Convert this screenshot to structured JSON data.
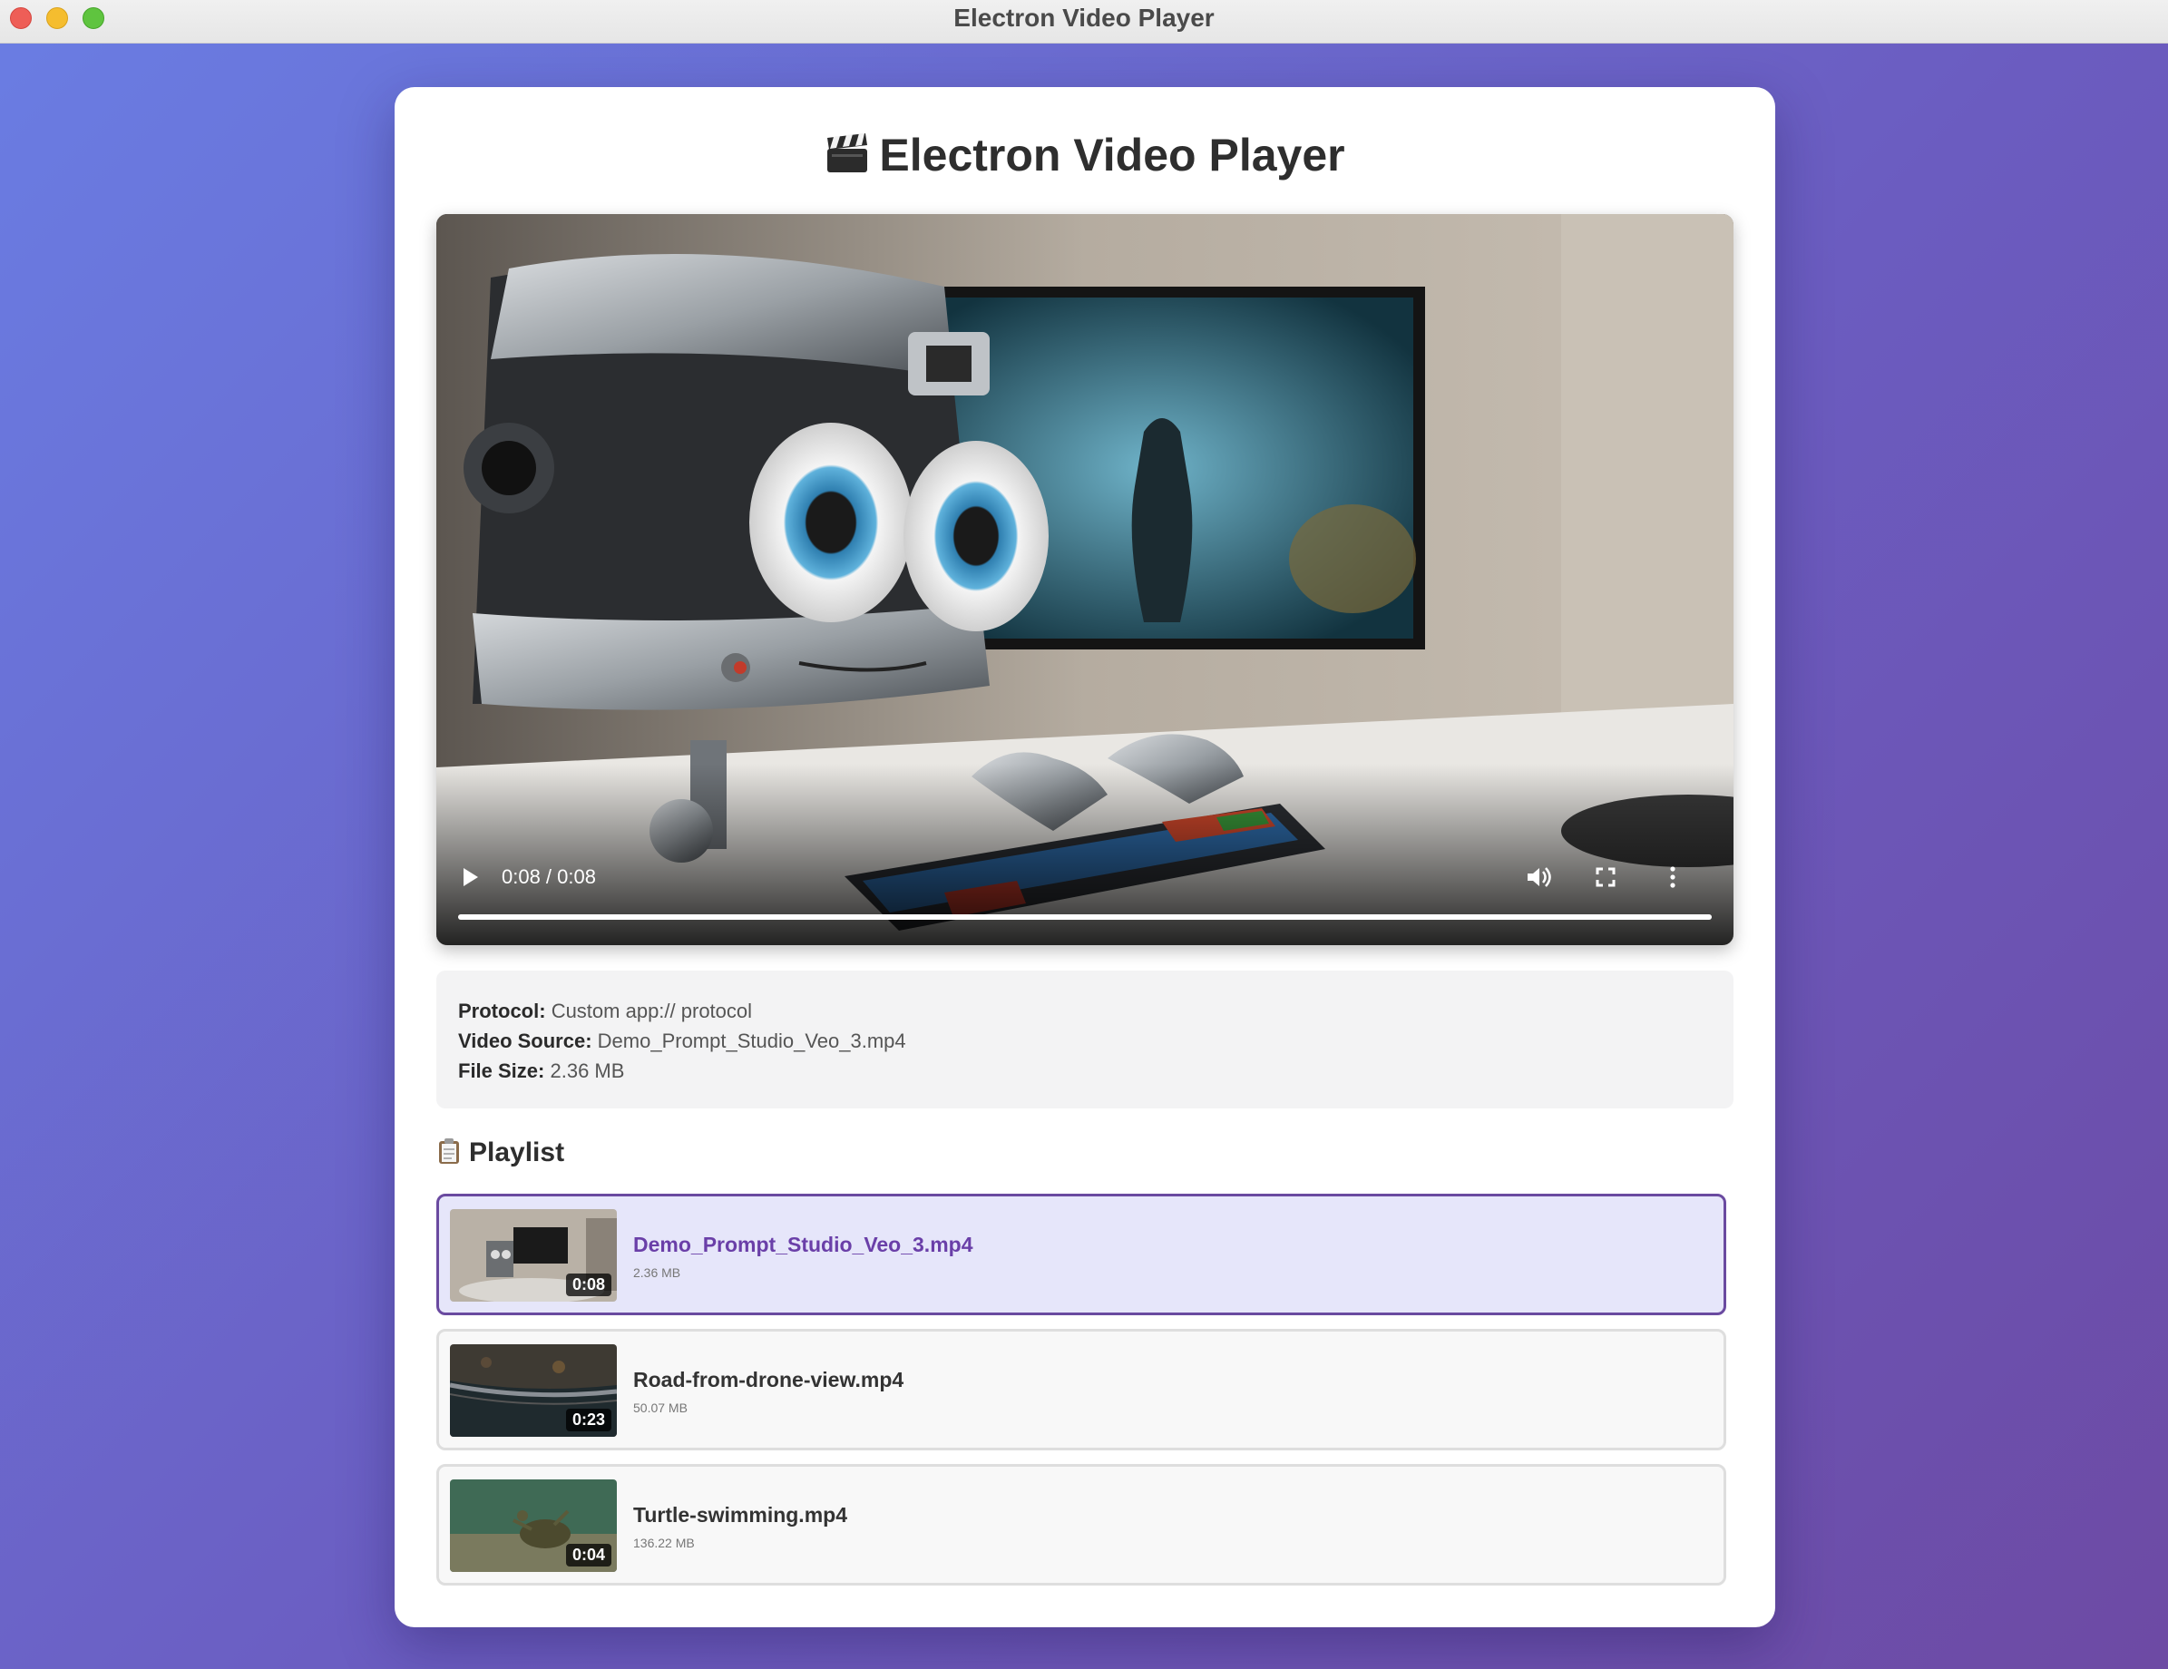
{
  "window": {
    "title": "Electron Video Player"
  },
  "app": {
    "title": "Electron Video Player"
  },
  "video": {
    "time_display": "0:08 / 0:08",
    "progress": 1.0
  },
  "info": {
    "protocol_label": "Protocol:",
    "protocol_value": "Custom app:// protocol",
    "source_label": "Video Source:",
    "source_value": "Demo_Prompt_Studio_Veo_3.mp4",
    "size_label": "File Size:",
    "size_value": "2.36 MB"
  },
  "playlist": {
    "title": "Playlist",
    "items": [
      {
        "name": "Demo_Prompt_Studio_Veo_3.mp4",
        "size": "2.36 MB",
        "duration": "0:08",
        "active": true
      },
      {
        "name": "Road-from-drone-view.mp4",
        "size": "50.07 MB",
        "duration": "0:23",
        "active": false
      },
      {
        "name": "Turtle-swimming.mp4",
        "size": "136.22 MB",
        "duration": "0:04",
        "active": false
      }
    ]
  },
  "colors": {
    "accent": "#6a3fa8",
    "active_bg": "#e6e6fa",
    "bg_gradient_start": "#6a7de3",
    "bg_gradient_end": "#6d4aa4"
  },
  "icons": {
    "title": "clapperboard-icon",
    "playlist": "clipboard-icon",
    "play": "play-icon",
    "volume": "volume-icon",
    "fullscreen": "fullscreen-icon",
    "more": "more-vertical-icon"
  }
}
